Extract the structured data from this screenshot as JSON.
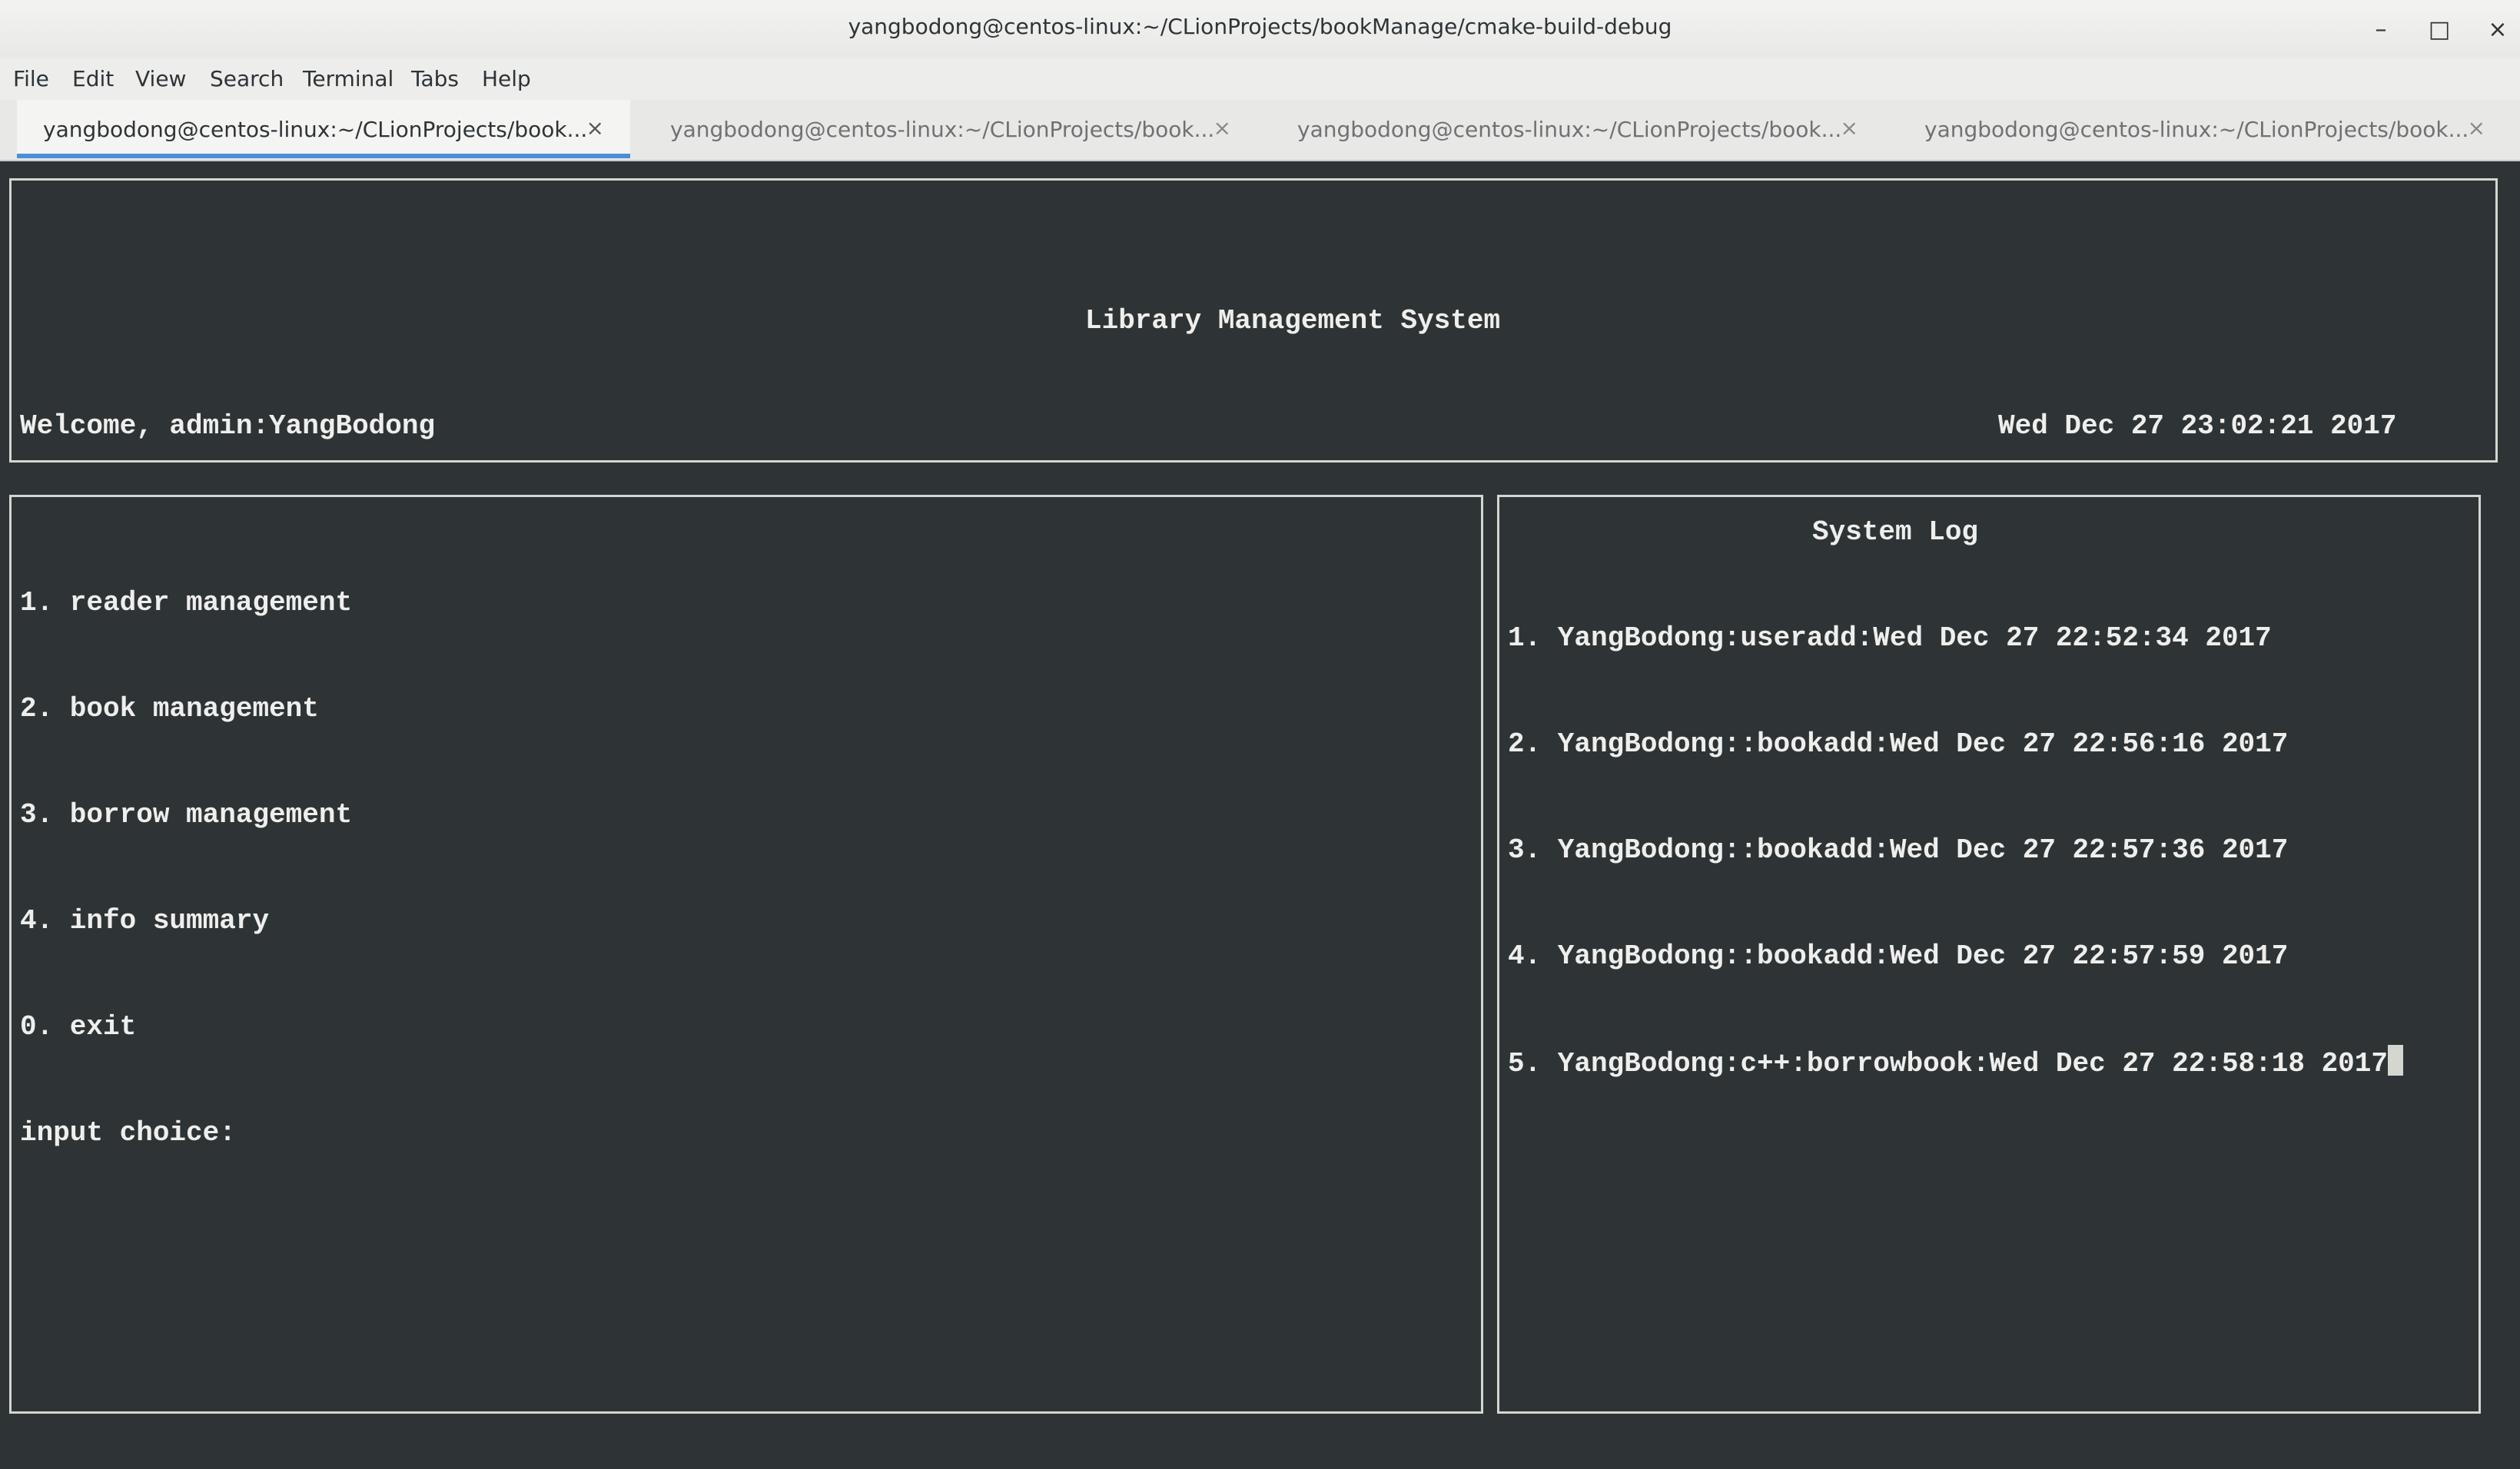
{
  "window": {
    "title": "yangbodong@centos-linux:~/CLionProjects/bookManage/cmake-build-debug",
    "controls": {
      "minimize": "–",
      "maximize": "□",
      "close": "×"
    }
  },
  "menubar": {
    "items": [
      "File",
      "Edit",
      "View",
      "Search",
      "Terminal",
      "Tabs",
      "Help"
    ]
  },
  "tabs": [
    {
      "label": "yangbodong@centos-linux:~/CLionProjects/book...",
      "close": "×",
      "active": true
    },
    {
      "label": "yangbodong@centos-linux:~/CLionProjects/book...",
      "close": "×",
      "active": false
    },
    {
      "label": "yangbodong@centos-linux:~/CLionProjects/book...",
      "close": "×",
      "active": false
    },
    {
      "label": "yangbodong@centos-linux:~/CLionProjects/book...",
      "close": "×",
      "active": false
    }
  ],
  "terminal": {
    "header": {
      "title": "Library Management System",
      "welcome": "Welcome, admin:YangBodong",
      "datetime": "Wed Dec 27 23:02:21 2017"
    },
    "menu": {
      "items": [
        "1. reader management",
        "2. book management",
        "3. borrow management",
        "4. info summary",
        "0. exit"
      ],
      "prompt": "input choice:"
    },
    "log": {
      "title": "System Log",
      "entries": [
        "1. YangBodong:useradd:Wed Dec 27 22:52:34 2017",
        "2. YangBodong::bookadd:Wed Dec 27 22:56:16 2017",
        "3. YangBodong::bookadd:Wed Dec 27 22:57:36 2017",
        "4. YangBodong::bookadd:Wed Dec 27 22:57:59 2017",
        "5. YangBodong:c++:borrowbook:Wed Dec 27 22:58:18 2017"
      ]
    }
  }
}
